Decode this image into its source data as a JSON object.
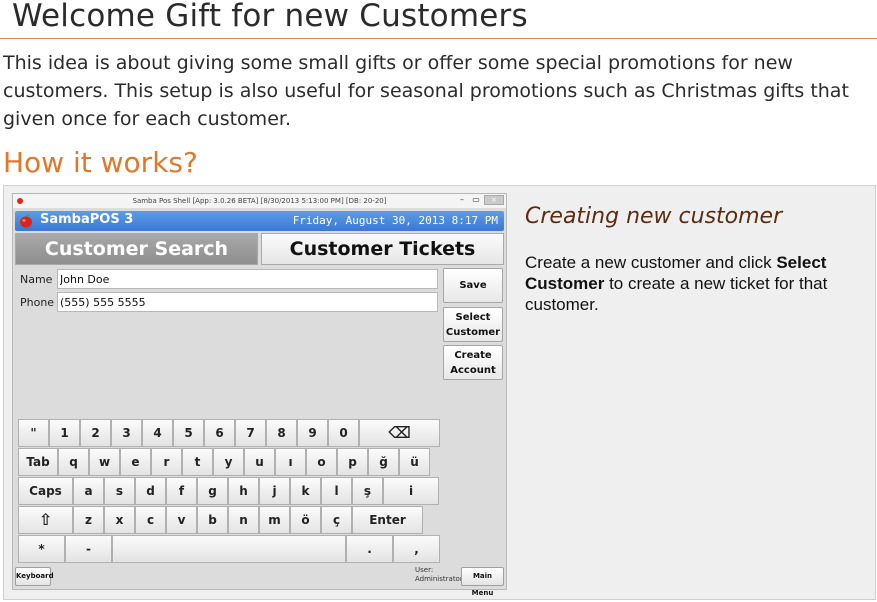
{
  "slide": {
    "title": "Welcome Gift for new Customers",
    "intro": "This idea is about giving some small gifts or offer some special promotions for new customers. This setup is also useful for seasonal promotions such as Christmas gifts that given once for each customer.",
    "section_title": "How it works?",
    "subtitle": "Creating new customer",
    "desc_before": "Create a new customer and click ",
    "desc_bold": "Select Customer",
    "desc_after": " to create a new ticket for that customer."
  },
  "app": {
    "window_title": "Samba Pos Shell [App: 3.0.26 BETA] [8/30/2013 5:13:00 PM] [DB: 20-20]",
    "window_close": "×",
    "name": "SambaPOS 3",
    "datetime": "Friday, August 30, 2013 8:17 PM",
    "tabs": [
      "Customer Search",
      "Customer Tickets"
    ],
    "fields": {
      "name_label": "Name",
      "name_value": "John Doe",
      "phone_label": "Phone",
      "phone_value": "(555) 555 5555"
    },
    "buttons": {
      "save": "Save",
      "select_customer_1": "Select",
      "select_customer_2": "Customer",
      "create_account_1": "Create",
      "create_account_2": "Account",
      "keyboard": "Keyboard",
      "main_menu": "Main Menu"
    },
    "user_label": "User:",
    "user_name": "Administrator",
    "keyboard_rows": [
      [
        "\"",
        "1",
        "2",
        "3",
        "4",
        "5",
        "6",
        "7",
        "8",
        "9",
        "0",
        "⌫"
      ],
      [
        "Tab",
        "q",
        "w",
        "e",
        "r",
        "t",
        "y",
        "u",
        "ı",
        "o",
        "p",
        "ğ",
        "ü"
      ],
      [
        "Caps",
        "a",
        "s",
        "d",
        "f",
        "g",
        "h",
        "j",
        "k",
        "l",
        "ş",
        "i"
      ],
      [
        "⇧",
        "z",
        "x",
        "c",
        "v",
        "b",
        "n",
        "m",
        "ö",
        "ç",
        "Enter"
      ],
      [
        "*",
        "-",
        "",
        ".",
        ","
      ]
    ]
  }
}
